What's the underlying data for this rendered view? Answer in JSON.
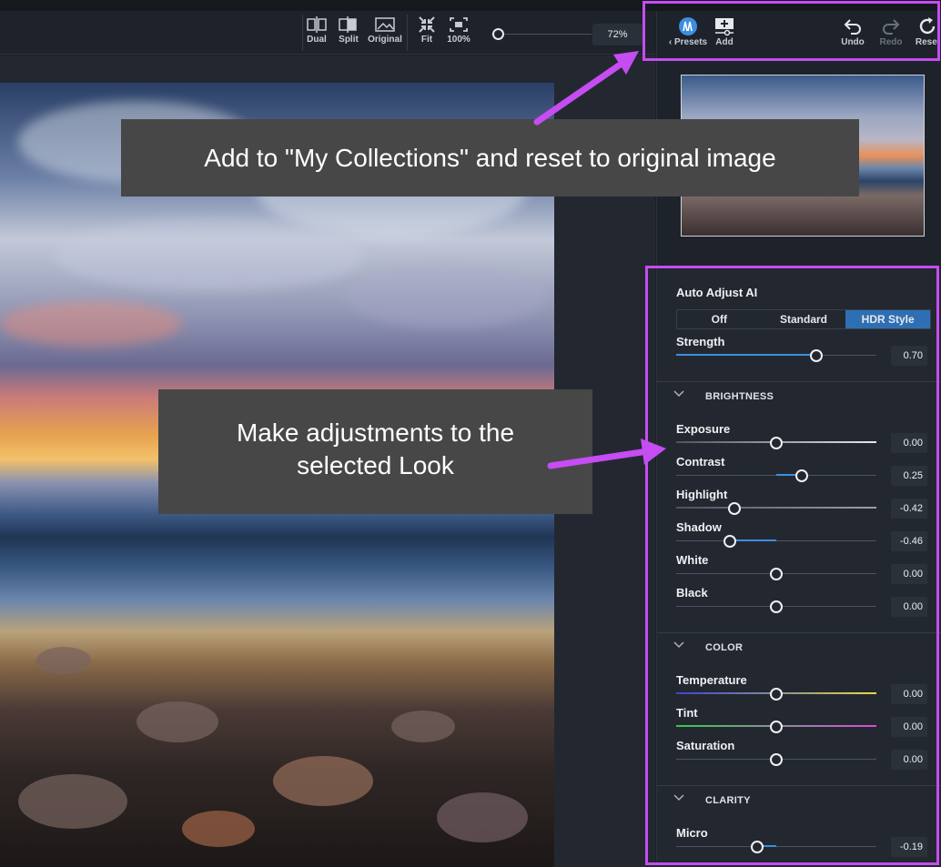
{
  "toolbar": {
    "buttons": [
      {
        "label": "Dual",
        "icon": "dual-view-icon"
      },
      {
        "label": "Split",
        "icon": "split-view-icon"
      },
      {
        "label": "Original",
        "icon": "original-image-icon"
      },
      {
        "label": "Fit",
        "icon": "fit-icon"
      },
      {
        "label": "100%",
        "icon": "zoom-100-icon"
      }
    ],
    "zoom_value": "72%"
  },
  "panel_header": {
    "presets_label": "‹ Presets",
    "add_label": "Add",
    "undo_label": "Undo",
    "redo_label": "Redo",
    "reset_label": "Reset"
  },
  "auto_adjust": {
    "title": "Auto Adjust AI",
    "options": [
      "Off",
      "Standard",
      "HDR Style"
    ],
    "selected": "HDR Style",
    "strength_label": "Strength",
    "strength_value": "0.70",
    "strength_level": 0.7
  },
  "brightness": {
    "title": "BRIGHTNESS",
    "sliders": [
      {
        "label": "Exposure",
        "value": "0.00",
        "level": 0.0
      },
      {
        "label": "Contrast",
        "value": "0.25",
        "level": 0.25
      },
      {
        "label": "Highlight",
        "value": "-0.42",
        "level": -0.42
      },
      {
        "label": "Shadow",
        "value": "-0.46",
        "level": -0.46
      },
      {
        "label": "White",
        "value": "0.00",
        "level": 0.0
      },
      {
        "label": "Black",
        "value": "0.00",
        "level": 0.0
      }
    ]
  },
  "color": {
    "title": "COLOR",
    "sliders": [
      {
        "label": "Temperature",
        "value": "0.00",
        "level": 0.0
      },
      {
        "label": "Tint",
        "value": "0.00",
        "level": 0.0
      },
      {
        "label": "Saturation",
        "value": "0.00",
        "level": 0.0
      }
    ]
  },
  "clarity": {
    "title": "CLARITY",
    "sliders": [
      {
        "label": "Micro",
        "value": "-0.19",
        "level": -0.19
      }
    ]
  },
  "annotations": {
    "top": "Add to \"My Collections\" and reset to original image",
    "middle_line1": "Make adjustments to the",
    "middle_line2": "selected Look"
  },
  "colors": {
    "accent": "#3d8ee0",
    "highlight_box": "#c64cf3",
    "active_segment": "#2e6fb3"
  }
}
